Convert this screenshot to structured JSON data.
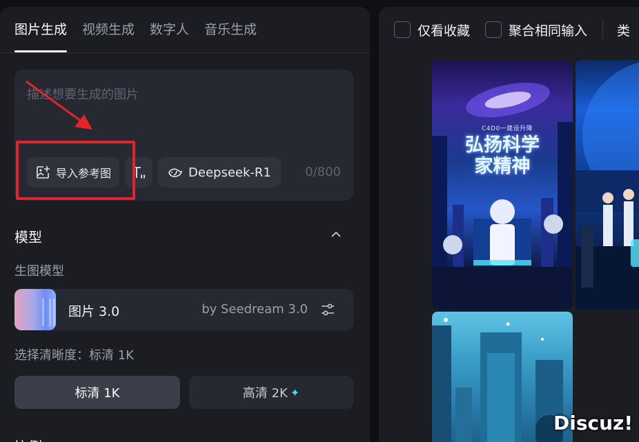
{
  "left": {
    "tabs": [
      "图片生成",
      "视频生成",
      "数字人",
      "音乐生成"
    ],
    "prompt": {
      "placeholder": "描述想要生成的图片",
      "import_label": "导入参考图",
      "model_label": "Deepseek-R1",
      "counter": "0/800"
    },
    "model_section": {
      "title": "模型",
      "sub_label": "生图模型",
      "model_name": "图片 3.0",
      "model_by": "by Seedream 3.0"
    },
    "resolution": {
      "label": "选择清晰度：标清 1K",
      "options": [
        "标清 1K",
        "高清 2K"
      ],
      "selected": "标清 1K"
    },
    "next_section_title": "比例"
  },
  "right": {
    "filters": [
      "仅看收藏",
      "聚合相同输入"
    ],
    "more": "类",
    "poster": {
      "tag": "C4D0一建设升降",
      "title_line1": "弘扬科学",
      "title_line2": "家精神"
    }
  },
  "watermark": "Discuz!",
  "colors": {
    "highlight": "#e3242b",
    "accent_sparkle": "#3fe0ff",
    "panel_bg": "#1b1d23"
  }
}
